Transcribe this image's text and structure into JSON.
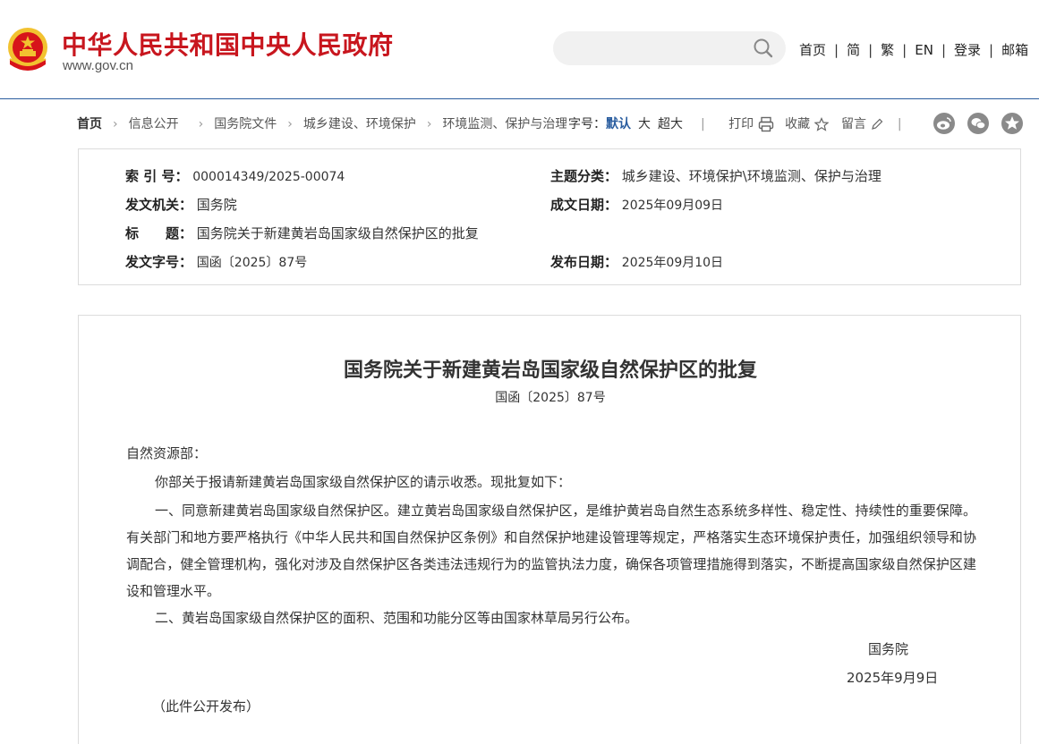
{
  "header": {
    "site_title": "中华人民共和国中央人民政府",
    "site_domain": "www.gov.cn",
    "search_placeholder": "",
    "nav": [
      "首页",
      "简",
      "繁",
      "EN",
      "登录",
      "邮箱"
    ]
  },
  "breadcrumb": [
    "首页",
    "信息公开",
    "国务院文件",
    "城乡建设、环境保护",
    "环境监测、保护与治理"
  ],
  "font_size": {
    "label": "字号：",
    "options": [
      "默认",
      "大",
      "超大"
    ],
    "selected": "默认"
  },
  "tools": {
    "print": "打印",
    "favorite": "收藏",
    "comment": "留言"
  },
  "social_icons": [
    "weibo-icon",
    "wechat-icon",
    "qzone-icon"
  ],
  "info": {
    "index_label": "索 引 号：",
    "index_value": "000014349/2025-00074",
    "topic_label": "主题分类：",
    "topic_value": "城乡建设、环境保护\\环境监测、保护与治理",
    "issuer_label": "发文机关：",
    "issuer_value": "国务院",
    "written_date_label": "成文日期：",
    "written_date_value": "2025年09月09日",
    "title_label": "标　　题：",
    "title_value": "国务院关于新建黄岩岛国家级自然保护区的批复",
    "docno_label": "发文字号：",
    "docno_value": "国函〔2025〕87号",
    "publish_date_label": "发布日期：",
    "publish_date_value": "2025年09月10日"
  },
  "article": {
    "title": "国务院关于新建黄岩岛国家级自然保护区的批复",
    "doc_number": "国函〔2025〕87号",
    "salutation": "自然资源部：",
    "paragraphs": [
      "你部关于报请新建黄岩岛国家级自然保护区的请示收悉。现批复如下：",
      "一、同意新建黄岩岛国家级自然保护区。建立黄岩岛国家级自然保护区，是维护黄岩岛自然生态系统多样性、稳定性、持续性的重要保障。有关部门和地方要严格执行《中华人民共和国自然保护区条例》和自然保护地建设管理等规定，严格落实生态环境保护责任，加强组织领导和协调配合，健全管理机构，强化对涉及自然保护区各类违法违规行为的监管执法力度，确保各项管理措施得到落实，不断提高国家级自然保护区建设和管理水平。",
      "二、黄岩岛国家级自然保护区的面积、范围和功能分区等由国家林草局另行公布。"
    ],
    "signer": "国务院",
    "sign_date": "2025年9月9日",
    "note": "（此件公开发布）"
  },
  "colors": {
    "brand_red": "#c8161e",
    "accent_blue": "#2a5d9f",
    "emblem_gold": "#f2c230"
  }
}
